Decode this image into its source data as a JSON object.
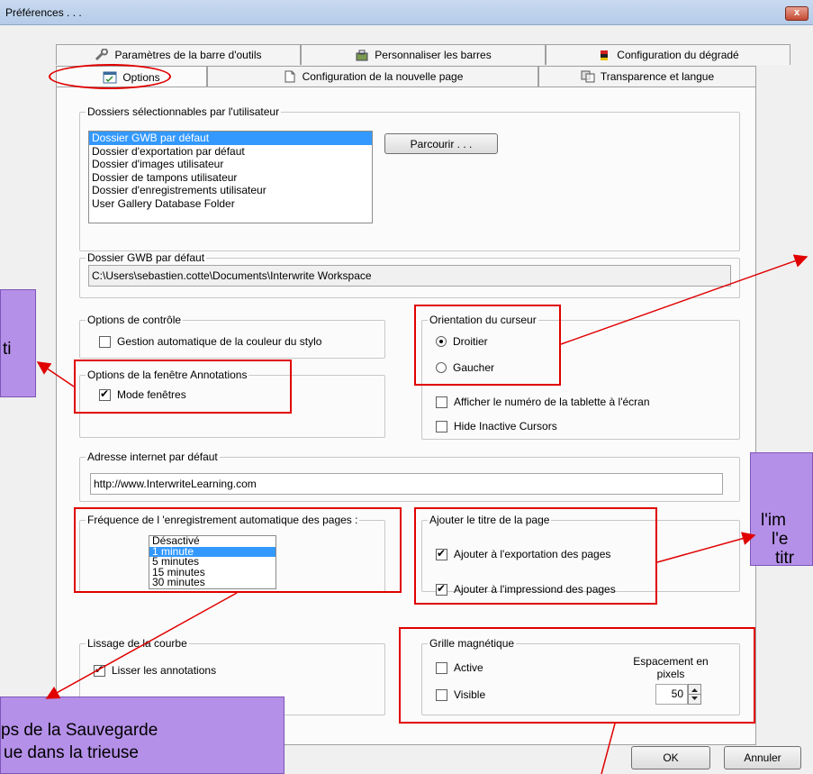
{
  "window": {
    "title": "Préférences . . .",
    "close_glyph": "x"
  },
  "tabs_row1": [
    {
      "label": "Paramètres de la barre d'outils",
      "icon": "wrench-icon"
    },
    {
      "label": "Personnaliser les barres",
      "icon": "toolbox-icon"
    },
    {
      "label": "Configuration du dégradé",
      "icon": "color-gradient-icon"
    }
  ],
  "tabs_row2": [
    {
      "label": "Options",
      "icon": "options-icon",
      "selected": true
    },
    {
      "label": "Configuration de la nouvelle page",
      "icon": "page-icon"
    },
    {
      "label": "Transparence et langue",
      "icon": "transparency-icon"
    }
  ],
  "folders": {
    "legend": "Dossiers sélectionnables par l'utilisateur",
    "items": [
      "Dossier GWB par défaut",
      "Dossier d'exportation par défaut",
      "Dossier d'images utilisateur",
      "Dossier de tampons utilisateur",
      "Dossier d'enregistrements utilisateur",
      "User Gallery Database Folder"
    ],
    "selected_index": 0,
    "browse_label": "Parcourir . . .",
    "path_legend": "Dossier GWB par défaut",
    "path_value": "C:\\Users\\sebastien.cotte\\Documents\\Interwrite Workspace"
  },
  "control_options": {
    "legend": "Options de contrôle",
    "auto_color": {
      "label": "Gestion automatique de la couleur du stylo",
      "checked": false
    }
  },
  "annotation_window": {
    "legend": "Options de la fenêtre Annotations",
    "window_mode": {
      "label": "Mode fenêtres",
      "checked": true
    }
  },
  "cursor": {
    "legend": "Orientation du curseur",
    "right": {
      "label": "Droitier",
      "selected": true
    },
    "left": {
      "label": "Gaucher",
      "selected": false
    },
    "show_tablet": {
      "label": "Afficher le numéro de la tablette à l'écran",
      "checked": false
    },
    "hide_inactive": {
      "label": "Hide Inactive Cursors",
      "checked": false
    }
  },
  "url": {
    "legend": "Adresse internet par défaut",
    "value": "http://www.InterwriteLearning.com"
  },
  "autosave": {
    "legend": "Fréquence de l 'enregistrement automatique des pages :",
    "items": [
      "Désactivé",
      "1 minute",
      "5 minutes",
      "15 minutes",
      "30 minutes"
    ],
    "selected_index": 1
  },
  "page_title": {
    "legend": "Ajouter le titre de la page",
    "export": {
      "label": "Ajouter à l'exportation des pages",
      "checked": true
    },
    "print": {
      "label": "Ajouter à l'impressiond des pages",
      "checked": true
    }
  },
  "smoothing": {
    "legend": "Lissage de la courbe",
    "smooth": {
      "label": "Lisser les annotations",
      "checked": true
    }
  },
  "grid": {
    "legend": "Grille magnétique",
    "active": {
      "label": "Active",
      "checked": false
    },
    "visible": {
      "label": "Visible",
      "checked": false
    },
    "spacing_label": "Espacement en pixels",
    "spacing_value": "50"
  },
  "buttons": {
    "ok": "OK",
    "cancel": "Annuler"
  },
  "callouts": {
    "left": "ti",
    "right_lines": [
      "l'im",
      "l'e",
      "titr"
    ],
    "bottom_lines": [
      "ps de la Sauvegarde",
      "ue dans la trieuse"
    ]
  },
  "colors": {
    "annotation_red": "#e00000",
    "callout_purple": "#b590e8",
    "selection_blue": "#3399ff"
  }
}
